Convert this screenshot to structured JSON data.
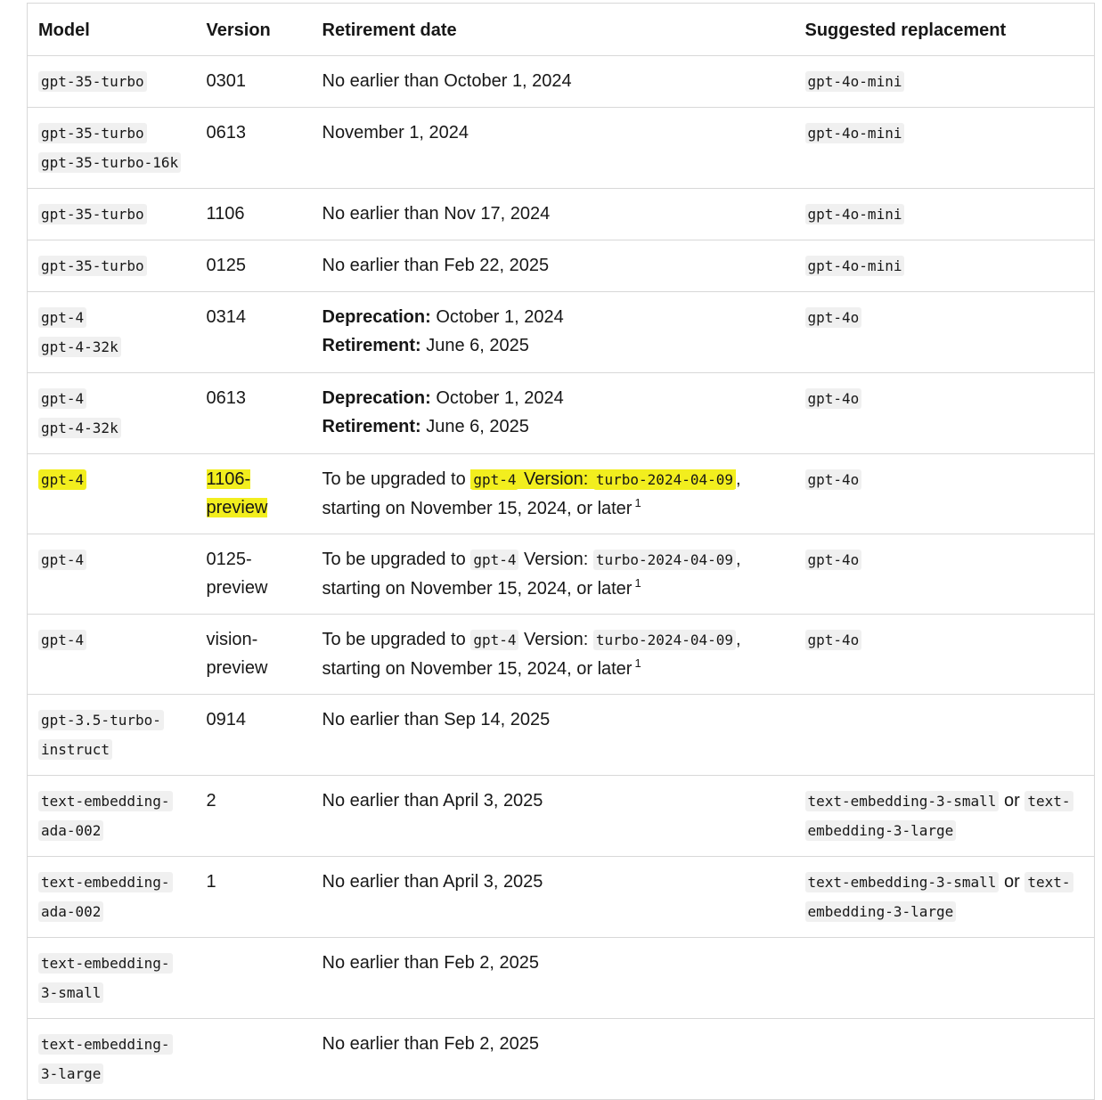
{
  "headers": {
    "model": "Model",
    "version": "Version",
    "retirement": "Retirement date",
    "replacement": "Suggested replacement"
  },
  "labels": {
    "deprecation": "Deprecation:",
    "retirement": "Retirement:",
    "upgrade_prefix": "To be upgraded to",
    "version_word": "Version:",
    "upgrade_suffix": "starting on November 15, 2024, or later",
    "footnote": "1",
    "or": "or"
  },
  "rows": [
    {
      "models": [
        "gpt-35-turbo"
      ],
      "version": "0301",
      "retirement": "No earlier than October 1, 2024",
      "replacement": "gpt-4o-mini"
    },
    {
      "models": [
        "gpt-35-turbo",
        "gpt-35-turbo-16k"
      ],
      "version": "0613",
      "retirement": "November 1, 2024",
      "replacement": "gpt-4o-mini"
    },
    {
      "models": [
        "gpt-35-turbo"
      ],
      "version": "1106",
      "retirement": "No earlier than Nov 17, 2024",
      "replacement": "gpt-4o-mini"
    },
    {
      "models": [
        "gpt-35-turbo"
      ],
      "version": "0125",
      "retirement": "No earlier than Feb 22, 2025",
      "replacement": "gpt-4o-mini"
    },
    {
      "models": [
        "gpt-4",
        "gpt-4-32k"
      ],
      "version": "0314",
      "deprecation": "October 1, 2024",
      "retirement_date": "June 6, 2025",
      "replacement": "gpt-4o"
    },
    {
      "models": [
        "gpt-4",
        "gpt-4-32k"
      ],
      "version": "0613",
      "deprecation": "October 1, 2024",
      "retirement_date": "June 6, 2025",
      "replacement": "gpt-4o"
    },
    {
      "models": [
        "gpt-4"
      ],
      "version_lines": [
        "1106-",
        "preview"
      ],
      "upgrade_model": "gpt-4",
      "upgrade_version": "turbo-2024-04-09",
      "replacement": "gpt-4o",
      "highlighted": true
    },
    {
      "models": [
        "gpt-4"
      ],
      "version_lines": [
        "0125-",
        "preview"
      ],
      "upgrade_model": "gpt-4",
      "upgrade_version": "turbo-2024-04-09",
      "replacement": "gpt-4o"
    },
    {
      "models": [
        "gpt-4"
      ],
      "version_lines": [
        "vision-",
        "preview"
      ],
      "upgrade_model": "gpt-4",
      "upgrade_version": "turbo-2024-04-09",
      "replacement": "gpt-4o"
    },
    {
      "model_lines": [
        "gpt-3.5-turbo-",
        "instruct"
      ],
      "version": "0914",
      "retirement": "No earlier than Sep 14, 2025",
      "replacement": ""
    },
    {
      "model_lines": [
        "text-embedding-",
        "ada-002"
      ],
      "version": "2",
      "retirement": "No earlier than April 3, 2025",
      "replacement_a": "text-embedding-3-small",
      "replacement_b_lines": [
        "text-",
        "embedding-3-large"
      ]
    },
    {
      "model_lines": [
        "text-embedding-",
        "ada-002"
      ],
      "version": "1",
      "retirement": "No earlier than April 3, 2025",
      "replacement_a": "text-embedding-3-small",
      "replacement_b_lines": [
        "text-",
        "embedding-3-large"
      ]
    },
    {
      "model_lines": [
        "text-embedding-",
        "3-small"
      ],
      "version": "",
      "retirement": "No earlier than Feb 2, 2025",
      "replacement": ""
    },
    {
      "model_lines": [
        "text-embedding-",
        "3-large"
      ],
      "version": "",
      "retirement": "No earlier than Feb 2, 2025",
      "replacement": ""
    }
  ],
  "colors": {
    "highlight": "#f2ee1e",
    "code_bg": "#f0f0f0",
    "border": "#d8d8d8"
  }
}
